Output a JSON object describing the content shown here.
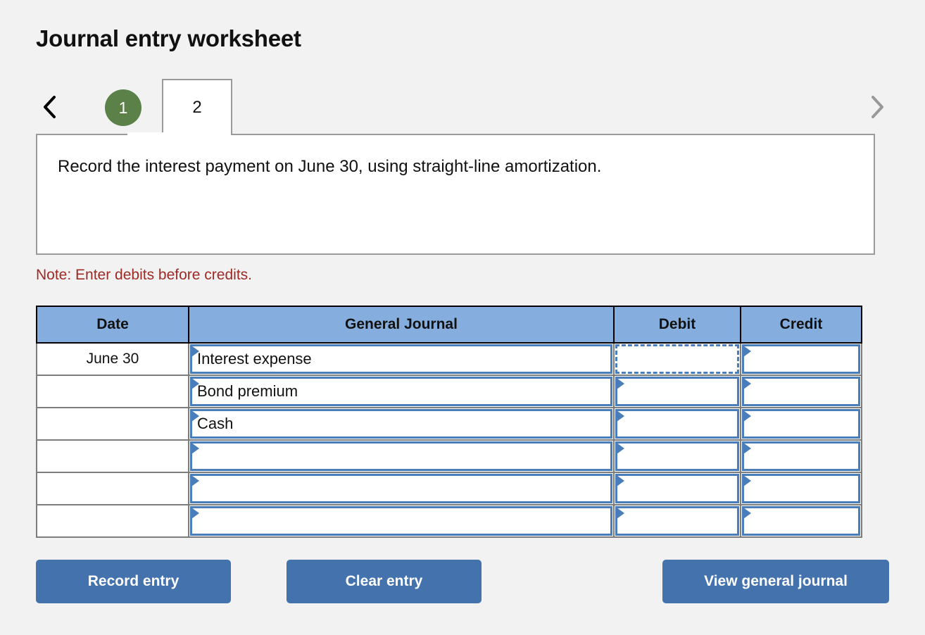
{
  "page_title": "Journal entry worksheet",
  "nav": {
    "prev_icon": "chevron-left-icon",
    "next_icon": "chevron-right-icon",
    "tabs": [
      {
        "label": "1",
        "state": "completed"
      },
      {
        "label": "2",
        "state": "active"
      }
    ]
  },
  "instruction": "Record the interest payment on June 30, using straight-line amortization.",
  "note": "Note: Enter debits before credits.",
  "table": {
    "headers": [
      "Date",
      "General Journal",
      "Debit",
      "Credit"
    ],
    "rows": [
      {
        "date": "June 30",
        "account": "Interest expense",
        "debit": "",
        "credit": "",
        "focus": "debit"
      },
      {
        "date": "",
        "account": "Bond premium",
        "debit": "",
        "credit": "",
        "focus": ""
      },
      {
        "date": "",
        "account": "Cash",
        "debit": "",
        "credit": "",
        "focus": ""
      },
      {
        "date": "",
        "account": "",
        "debit": "",
        "credit": "",
        "focus": ""
      },
      {
        "date": "",
        "account": "",
        "debit": "",
        "credit": "",
        "focus": ""
      },
      {
        "date": "",
        "account": "",
        "debit": "",
        "credit": "",
        "focus": ""
      }
    ]
  },
  "buttons": {
    "record": "Record entry",
    "clear": "Clear entry",
    "view": "View general journal"
  },
  "colors": {
    "background": "#f2f2f2",
    "tab_completed": "#5b8048",
    "header_blue": "#85aede",
    "button_blue": "#4472ad",
    "note_red": "#9e2a24",
    "dropdown_blue": "#4a7ebb"
  }
}
